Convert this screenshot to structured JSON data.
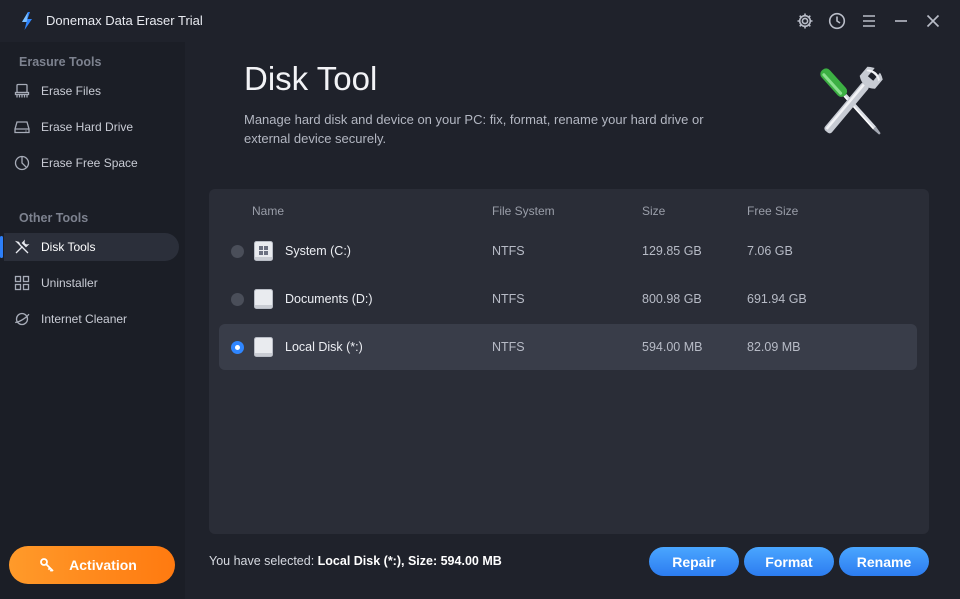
{
  "app": {
    "title": "Donemax Data Eraser Trial"
  },
  "window_controls": [
    "gear-icon",
    "history-icon",
    "menu-icon",
    "minimize-icon",
    "close-icon"
  ],
  "sidebar": {
    "sections": [
      {
        "title": "Erasure Tools",
        "items": [
          {
            "label": "Erase Files",
            "icon": "erase-files-icon"
          },
          {
            "label": "Erase Hard Drive",
            "icon": "hard-drive-icon"
          },
          {
            "label": "Erase Free Space",
            "icon": "pie-chart-icon"
          }
        ]
      },
      {
        "title": "Other Tools",
        "items": [
          {
            "label": "Disk Tools",
            "icon": "tools-icon",
            "active": true
          },
          {
            "label": "Uninstaller",
            "icon": "grid-apps-icon"
          },
          {
            "label": "Internet Cleaner",
            "icon": "planet-icon"
          }
        ]
      }
    ],
    "activation_label": "Activation"
  },
  "main": {
    "title": "Disk Tool",
    "description": "Manage hard disk and device on your PC: fix, format, rename your hard drive or external device securely.",
    "table": {
      "columns": [
        "Name",
        "File System",
        "Size",
        "Free Size"
      ],
      "rows": [
        {
          "name": "System (C:)",
          "fs": "NTFS",
          "size": "129.85 GB",
          "free": "7.06 GB",
          "selected": false
        },
        {
          "name": "Documents (D:)",
          "fs": "NTFS",
          "size": "800.98 GB",
          "free": "691.94 GB",
          "selected": false
        },
        {
          "name": "Local Disk (*:)",
          "fs": "NTFS",
          "size": "594.00 MB",
          "free": "82.09 MB",
          "selected": true
        }
      ]
    },
    "selection": {
      "prefix": "You have selected: ",
      "name": "Local Disk (*:)",
      "size_label": ", Size: ",
      "size": "594.00 MB"
    },
    "buttons": {
      "repair": "Repair",
      "format": "Format",
      "rename": "Rename"
    }
  },
  "colors": {
    "accent": "#2d7ff9",
    "activation": "#ff8a1c",
    "background": "#1f222b"
  }
}
